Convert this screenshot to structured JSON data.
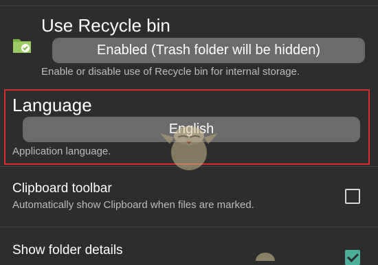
{
  "recycle_bin": {
    "title": "Use Recycle bin",
    "value": "Enabled (Trash folder will be hidden)",
    "description": "Enable or disable use of Recycle bin for internal storage.",
    "icon": "folder-recycle-icon"
  },
  "language": {
    "title": "Language",
    "value": "English",
    "description": "Application language."
  },
  "clipboard_toolbar": {
    "title": "Clipboard toolbar",
    "description": "Automatically show Clipboard when files are marked.",
    "checked": false
  },
  "folder_details": {
    "title": "Show folder details",
    "checked": true
  },
  "colors": {
    "background": "#2d2d2d",
    "pill": "#6b6b6b",
    "highlight": "#d32f2f",
    "accent": "#4caf9a"
  }
}
